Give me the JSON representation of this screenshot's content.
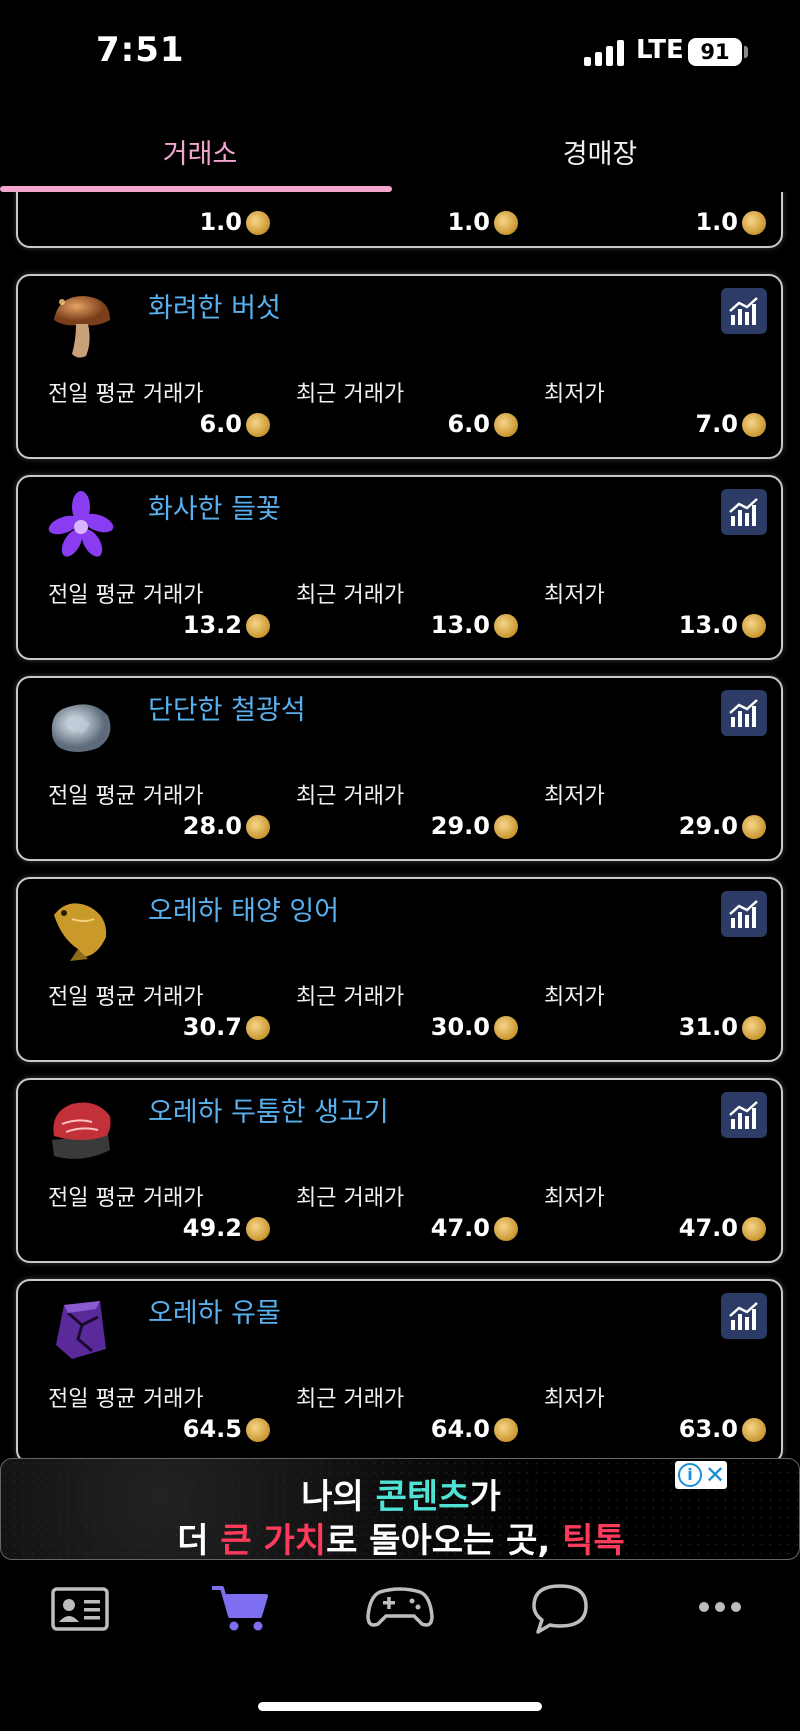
{
  "status_bar": {
    "time": "7:51",
    "network": "LTE",
    "battery": "91"
  },
  "tabs": [
    {
      "label": "거래소",
      "active": true
    },
    {
      "label": "경매장",
      "active": false
    }
  ],
  "column_labels": {
    "prev_avg": "전일 평균 거래가",
    "recent": "최근 거래가",
    "lowest": "최저가"
  },
  "partial_card": {
    "prev_avg": "1.0",
    "recent": "1.0",
    "lowest": "1.0"
  },
  "items": [
    {
      "name": "화려한 버섯",
      "icon": "mushroom-icon",
      "prev_avg": "6.0",
      "recent": "6.0",
      "lowest": "7.0"
    },
    {
      "name": "화사한 들꽃",
      "icon": "purple-flower-icon",
      "prev_avg": "13.2",
      "recent": "13.0",
      "lowest": "13.0"
    },
    {
      "name": "단단한 철광석",
      "icon": "iron-ore-icon",
      "prev_avg": "28.0",
      "recent": "29.0",
      "lowest": "29.0"
    },
    {
      "name": "오레하 태양 잉어",
      "icon": "golden-carp-icon",
      "prev_avg": "30.7",
      "recent": "30.0",
      "lowest": "31.0"
    },
    {
      "name": "오레하 두툼한 생고기",
      "icon": "raw-meat-icon",
      "prev_avg": "49.2",
      "recent": "47.0",
      "lowest": "47.0"
    },
    {
      "name": "오레하 유물",
      "icon": "relic-stone-icon",
      "prev_avg": "64.5",
      "recent": "64.0",
      "lowest": "63.0"
    }
  ],
  "ad": {
    "line1_a": "나의 ",
    "line1_b": "콘텐츠",
    "line1_c": "가",
    "line2_a": "더 ",
    "line2_b": "큰 가치",
    "line2_c": "로 돌아오는 곳, ",
    "line2_d": "틱톡",
    "info": "i",
    "close": "✕"
  },
  "colors": {
    "accent_pink": "#f3a7cf",
    "item_blue": "#58b0ee",
    "chart_button": "#2c3c66",
    "nav_active": "#7e6ff0"
  },
  "bottom_nav": [
    {
      "icon": "profile-card-icon",
      "active": false
    },
    {
      "icon": "cart-icon",
      "active": true
    },
    {
      "icon": "gamepad-icon",
      "active": false
    },
    {
      "icon": "chat-bubble-icon",
      "active": false
    },
    {
      "icon": "more-dots-icon",
      "active": false
    }
  ]
}
